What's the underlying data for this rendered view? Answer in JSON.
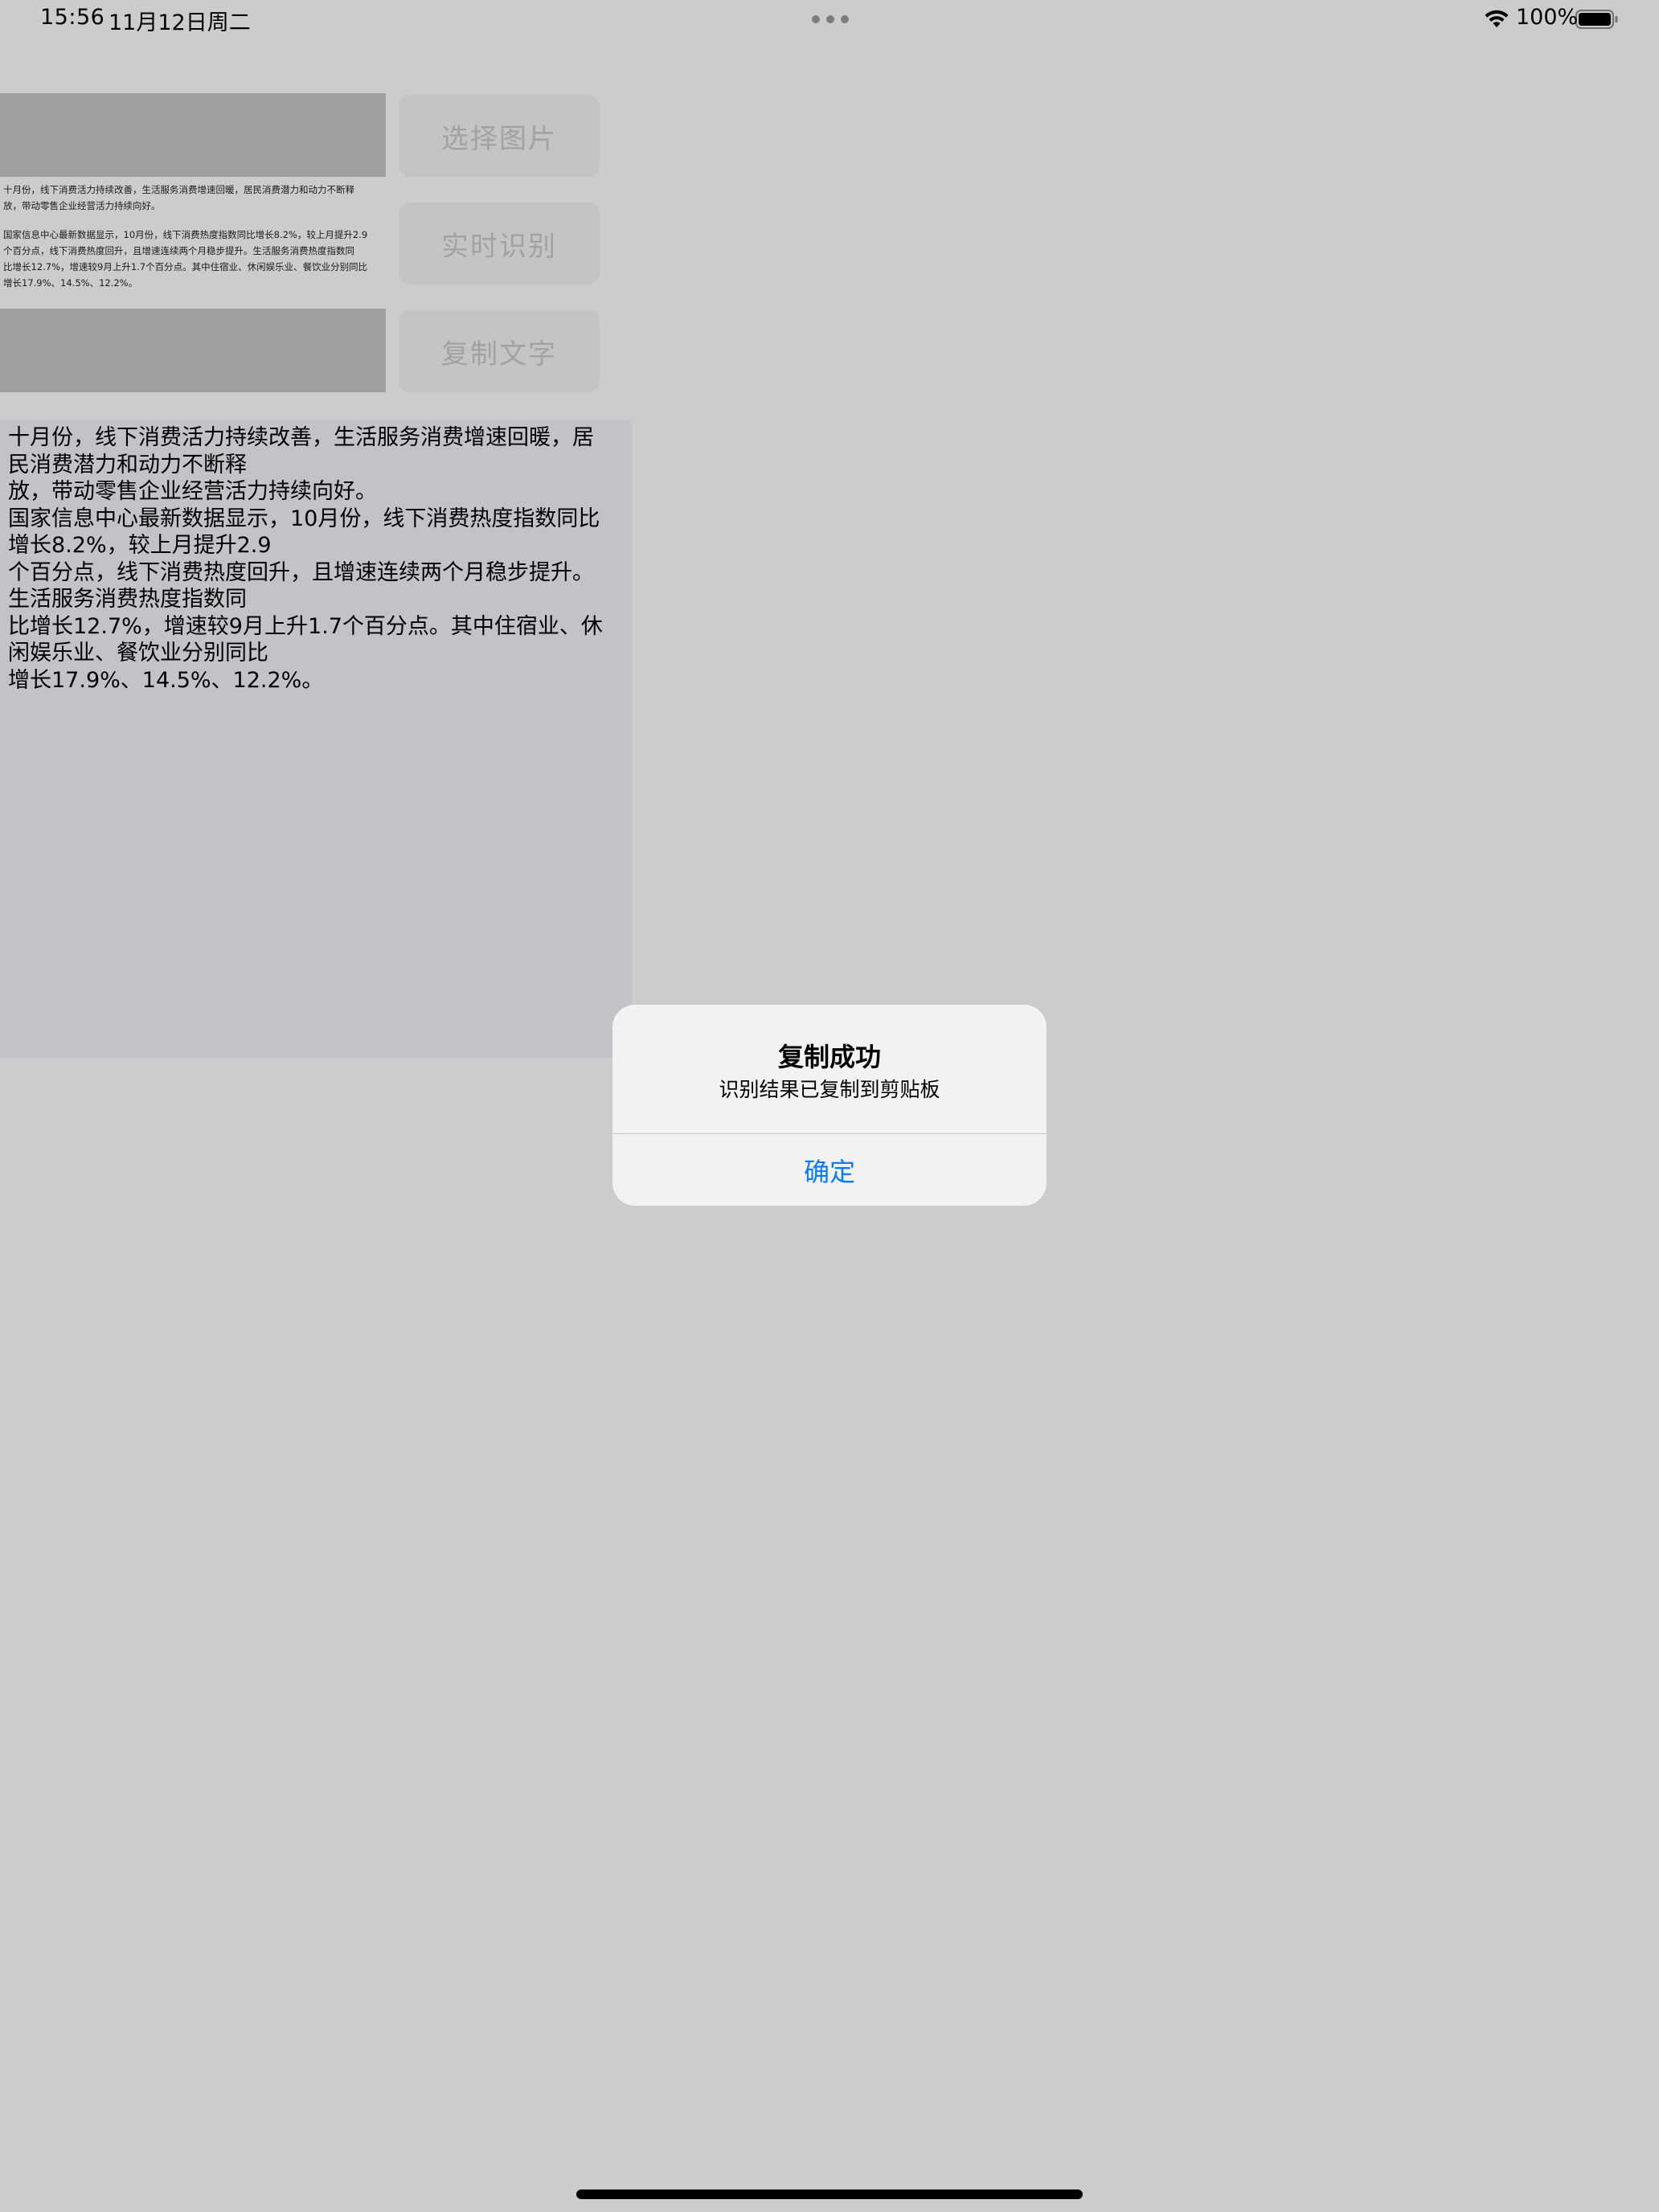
{
  "status_bar": {
    "time": "15:56",
    "date": "11月12日周二",
    "battery_percent": "100%",
    "wifi_icon": "wifi-icon",
    "battery_icon": "battery-icon",
    "battery_level": 1.0
  },
  "image_preview": {
    "paragraphs": [
      [
        "十月份，线下消费活力持续改善，生活服务消费增速回暖，居民消费潜力和动力不断释",
        "放，带动零售企业经营活力持续向好。"
      ],
      [
        "国家信息中心最新数据显示，10月份，线下消费热度指数同比增长8.2%，较上月提升2.9",
        "个百分点，线下消费热度回升，且增速连续两个月稳步提升。生活服务消费热度指数同",
        "比增长12.7%，增速较9月上升1.7个百分点。其中住宿业、休闲娱乐业、餐饮业分别同比",
        "增长17.9%、14.5%、12.2%。"
      ]
    ]
  },
  "buttons": {
    "select_image": "选择图片",
    "realtime_recognize": "实时识别",
    "copy_text": "复制文字"
  },
  "result": {
    "lines": [
      "十月份，线下消费活力持续改善，生活服务消费增速回暖，居",
      "民消费潜力和动力不断释",
      "放，带动零售企业经营活力持续向好。",
      "国家信息中心最新数据显示，10月份，线下消费热度指数同比",
      "增长8.2%，较上月提升2.9",
      "个百分点，线下消费热度回升，且增速连续两个月稳步提升。",
      "生活服务消费热度指数同",
      "比增长12.7%，增速较9月上升1.7个百分点。其中住宿业、休",
      "闲娱乐业、餐饮业分别同比",
      "增长17.9%、14.5%、12.2%。"
    ]
  },
  "alert": {
    "title": "复制成功",
    "message": "识别结果已复制到剪贴板",
    "confirm": "确定"
  }
}
